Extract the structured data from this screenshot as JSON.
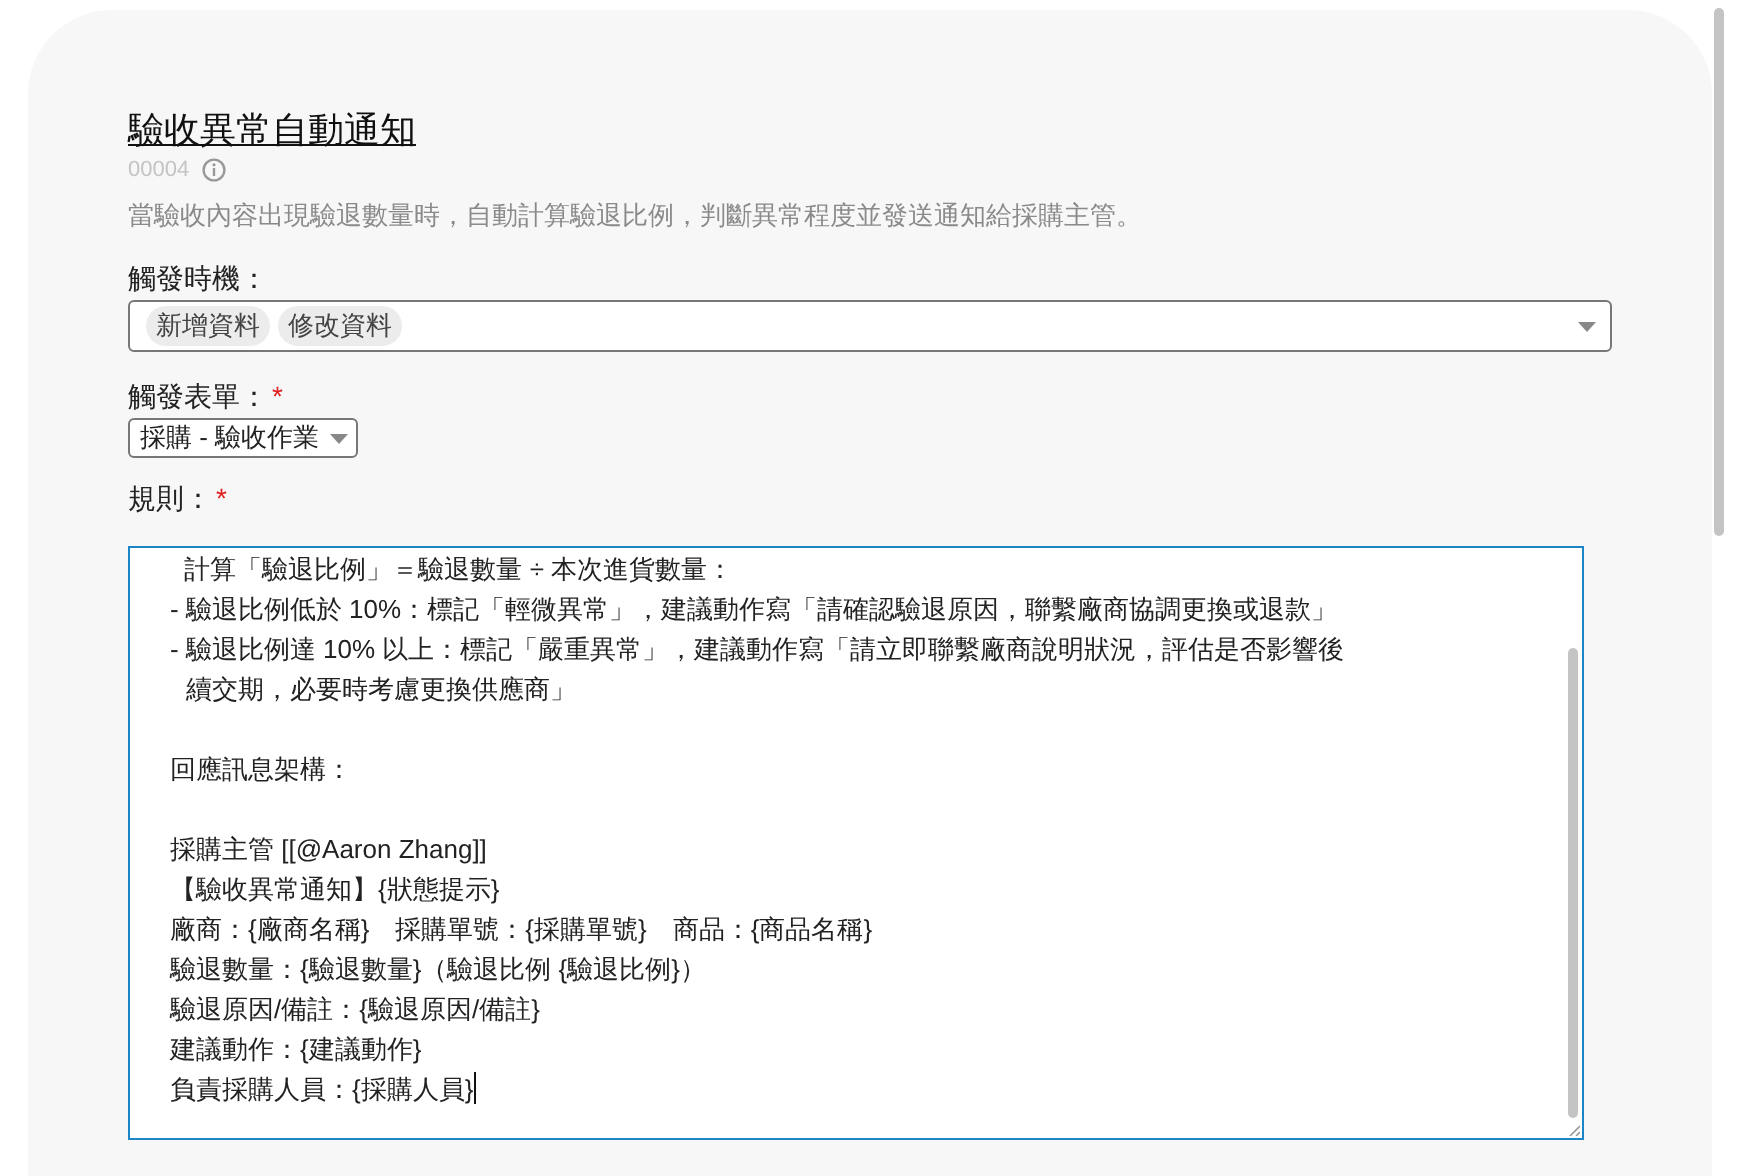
{
  "header": {
    "title": "驗收異常自動通知",
    "code": "00004",
    "description": "當驗收內容出現驗退數量時，自動計算驗退比例，判斷異常程度並發送通知給採購主管。"
  },
  "required_marker": "*",
  "fields": [
    {
      "kind": "tags",
      "label": "觸發時機：",
      "required": false,
      "tags": [
        "新增資料",
        "修改資料"
      ]
    },
    {
      "kind": "select",
      "label": "觸發表單：",
      "required": true,
      "value": "採購 - 驗收作業"
    },
    {
      "kind": "editor",
      "label": "規則：",
      "required": true,
      "focused": true,
      "paragraphs": [
        [
          "  計算「驗退比例」＝驗退數量 ÷ 本次進貨數量：",
          "- 驗退比例低於 10%：標記「輕微異常」，建議動作寫「請確認驗退原因，聯繫廠商協調更換或退款」",
          "- 驗退比例達 10% 以上：標記「嚴重異常」，建議動作寫「請立即聯繫廠商說明狀況，評估是否影響後續交期，必要時考慮更換供應商」"
        ],
        [
          "回應訊息架構："
        ],
        [
          "採購主管 [[@Aaron Zhang]]",
          "【驗收異常通知】{狀態提示}",
          "廠商：{廠商名稱}　採購單號：{採購單號}　商品：{商品名稱}",
          "驗退數量：{驗退數量}（驗退比例 {驗退比例}）",
          "驗退原因/備註：{驗退原因/備註}",
          "建議動作：{建議動作}",
          "負責採購人員：{採購人員}"
        ]
      ]
    }
  ]
}
